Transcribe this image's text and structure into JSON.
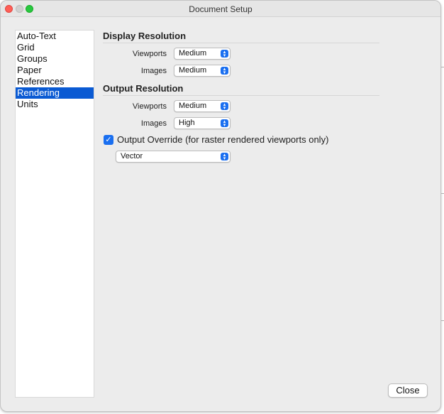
{
  "window": {
    "title": "Document Setup"
  },
  "sidebar": {
    "items": [
      {
        "label": "Auto-Text",
        "selected": false
      },
      {
        "label": "Grid",
        "selected": false
      },
      {
        "label": "Groups",
        "selected": false
      },
      {
        "label": "Paper",
        "selected": false
      },
      {
        "label": "References",
        "selected": false
      },
      {
        "label": "Rendering",
        "selected": true
      },
      {
        "label": "Units",
        "selected": false
      }
    ]
  },
  "display_resolution": {
    "title": "Display Resolution",
    "viewports_label": "Viewports",
    "viewports_value": "Medium",
    "images_label": "Images",
    "images_value": "Medium"
  },
  "output_resolution": {
    "title": "Output Resolution",
    "viewports_label": "Viewports",
    "viewports_value": "Medium",
    "images_label": "Images",
    "images_value": "High"
  },
  "output_override": {
    "checked": true,
    "label": "Output Override (for raster rendered viewports only)",
    "mode_value": "Vector"
  },
  "buttons": {
    "close_label": "Close"
  },
  "colors": {
    "accent": "#1a6ff0",
    "selection": "#0a5ad3"
  }
}
